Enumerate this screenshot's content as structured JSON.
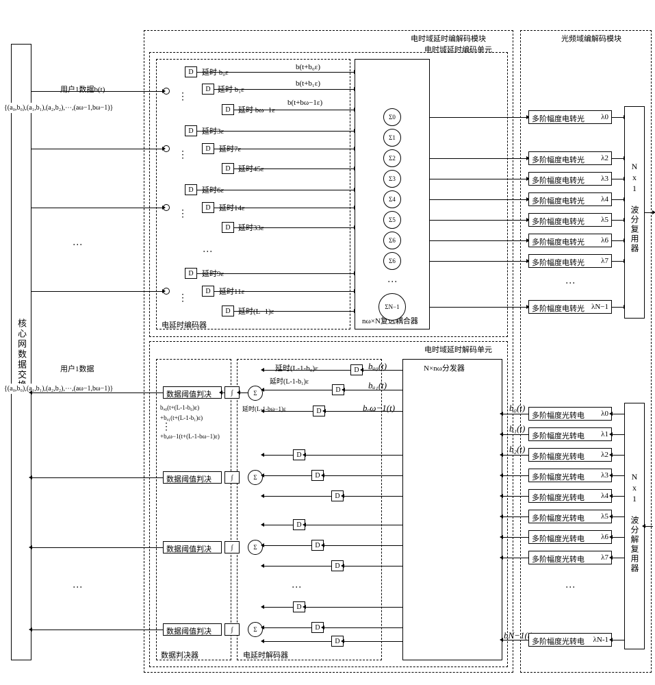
{
  "blocks": {
    "core_switch": "核心网数据交换",
    "elec_codec_module": "电时域延时编解码模块",
    "opt_codec_module": "光频域编解码模块",
    "elec_enc_unit": "电时域延时编码单元",
    "elec_dec_unit": "电时域延时解码单元",
    "elec_delay_encoder": "电延时编码器",
    "elec_delay_decoder": "电延时解码器",
    "data_judge": "数据判决器",
    "coupler": "nω×N复选耦合器",
    "distributor": "N×nω分发器",
    "wdm": "Nx1 波分复用器",
    "wddm": "Nx1 波分解复用器"
  },
  "labels": {
    "user1_data_tx": "用户1数据b(t)",
    "user1_data_rx": "用户1数据",
    "code_set": "{(a₀,b₀),(a₁,b₁),(a₂,b₂),⋯,(aω−1,bω−1)}",
    "delay_prefix": "延时",
    "delay_b0": "延时 b₀ε",
    "delay_b1": "延时 b₁ε",
    "delay_bw1": "延时 bω−1ε",
    "bt_b0": "b(t+b₀ε)",
    "bt_b1": "b(t+b₁ε)",
    "bt_bw1": "b(t+bω−1ε)",
    "d3e": "延时3ε",
    "d7e": "延时7ε",
    "d45e": "延时45ε",
    "d6e": "延时6ε",
    "d14e": "延时14ε",
    "d33e": "延时33ε",
    "d9e": "延时9ε",
    "d11e": "延时11ε",
    "dL1e": "延时(L−1)ε",
    "dL1b0": "延时(L-1-b₀)ε",
    "dL1b1": "延时(L-1-b₁)ε",
    "dL1bw1": "延时(L-1-bω−1)ε",
    "ba0t": "bₐ₀(t)",
    "ba1t": "bₐ₁(t)",
    "baw1t": "bₐω−1(t)",
    "b0t": "b₀(t)",
    "b1t": "b₁(t)",
    "b2t": "b₂(t)",
    "bN1t": "bN−1(t)",
    "sum_expr1": "bₐ₀(t+(L-1-b₀)ε)",
    "sum_expr2": "+bₐ₁(t+(L-1-b₁)ε)",
    "sum_expr3": "+bₐω−1(t+(L-1-bω−1)ε)",
    "threshold": "数据阈值判决",
    "e2o": "多阶幅度电转光",
    "o2e": "多阶幅度光转电",
    "sigma": "Σ",
    "D": "D",
    "sigma0": "Σ0",
    "sigma1": "Σ1",
    "sigma2": "Σ2",
    "sigma3": "Σ3",
    "sigma4": "Σ4",
    "sigma5": "Σ5",
    "sigma6a": "Σ6",
    "sigma6b": "Σ6",
    "sigmaN1": "ΣN−1",
    "lam0": "λ0",
    "lam2": "λ2",
    "lam3": "λ3",
    "lam4": "λ4",
    "lam5": "λ5",
    "lam6": "λ6",
    "lam7": "λ7",
    "lamN1": "λN−1",
    "olam0": "λ0",
    "olam1": "λ1",
    "olam2": "λ2",
    "olam3": "λ3",
    "olam4": "λ4",
    "olam5": "λ5",
    "olam6": "λ6",
    "olam7": "λ7",
    "olamN1": "λN-1"
  }
}
